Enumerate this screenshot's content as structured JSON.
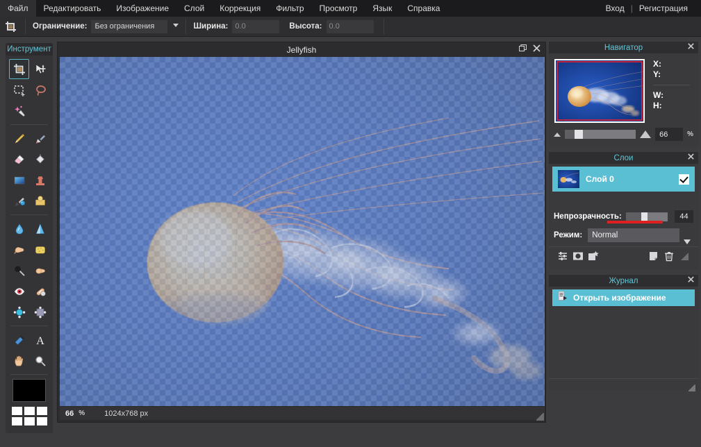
{
  "menu": {
    "items": [
      {
        "label": "Файл",
        "name": "menu-file"
      },
      {
        "label": "Редактировать",
        "name": "menu-edit"
      },
      {
        "label": "Изображение",
        "name": "menu-image"
      },
      {
        "label": "Слой",
        "name": "menu-layer"
      },
      {
        "label": "Коррекция",
        "name": "menu-adjustment"
      },
      {
        "label": "Фильтр",
        "name": "menu-filter"
      },
      {
        "label": "Просмотр",
        "name": "menu-view"
      },
      {
        "label": "Язык",
        "name": "menu-language"
      },
      {
        "label": "Справка",
        "name": "menu-help"
      }
    ],
    "login": "Вход",
    "separator": "|",
    "register": "Регистрация"
  },
  "options": {
    "tool_icon": "crop-icon",
    "constraint_label": "Ограничение:",
    "constraint_value": "Без ограничения",
    "width_label": "Ширина:",
    "width_value": "0.0",
    "height_label": "Высота:",
    "height_value": "0.0"
  },
  "tools": {
    "title": "Инструмент",
    "groups": [
      [
        {
          "icon": "crop-icon",
          "name": "tool-crop",
          "active": true
        },
        {
          "icon": "move-icon",
          "name": "tool-move",
          "active": false
        },
        {
          "icon": "marquee-select-icon",
          "name": "tool-marquee",
          "active": false
        },
        {
          "icon": "lasso-icon",
          "name": "tool-lasso",
          "active": false
        },
        {
          "icon": "magic-wand-icon",
          "name": "tool-magic-wand",
          "active": false
        }
      ],
      [
        {
          "icon": "pencil-icon",
          "name": "tool-pencil",
          "active": false
        },
        {
          "icon": "brush-icon",
          "name": "tool-brush",
          "active": false
        },
        {
          "icon": "eraser-icon",
          "name": "tool-eraser",
          "active": false
        },
        {
          "icon": "paint-bucket-icon",
          "name": "tool-paint-bucket",
          "active": false
        },
        {
          "icon": "gradient-icon",
          "name": "tool-gradient",
          "active": false
        },
        {
          "icon": "clone-stamp-icon",
          "name": "tool-clone-stamp",
          "active": false
        },
        {
          "icon": "color-replace-icon",
          "name": "tool-color-replace",
          "active": false
        },
        {
          "icon": "drawing-icon",
          "name": "tool-drawing",
          "active": false
        }
      ],
      [
        {
          "icon": "blur-drop-icon",
          "name": "tool-blur",
          "active": false
        },
        {
          "icon": "sharpen-icon",
          "name": "tool-sharpen",
          "active": false
        },
        {
          "icon": "smudge-finger-icon",
          "name": "tool-smudge",
          "active": false
        },
        {
          "icon": "sponge-icon",
          "name": "tool-sponge",
          "active": false
        },
        {
          "icon": "dodge-icon",
          "name": "tool-dodge",
          "active": false
        },
        {
          "icon": "burn-hand-icon",
          "name": "tool-burn",
          "active": false
        },
        {
          "icon": "red-eye-icon",
          "name": "tool-red-eye",
          "active": false
        },
        {
          "icon": "bandage-icon",
          "name": "tool-spot-heal",
          "active": false
        },
        {
          "icon": "bloat-icon",
          "name": "tool-bloat",
          "active": false
        },
        {
          "icon": "pinch-icon",
          "name": "tool-pinch",
          "active": false
        }
      ],
      [
        {
          "icon": "eyedropper-icon",
          "name": "tool-eyedropper",
          "active": false
        },
        {
          "icon": "text-icon",
          "name": "tool-text",
          "active": false
        },
        {
          "icon": "hand-icon",
          "name": "tool-hand",
          "active": false
        },
        {
          "icon": "zoom-magnifier-icon",
          "name": "tool-zoom",
          "active": false
        }
      ]
    ],
    "foreground_color": "#000000",
    "palette_colors": [
      "#ffffff",
      "#ffffff",
      "#ffffff",
      "#ffffff",
      "#ffffff",
      "#ffffff"
    ]
  },
  "document": {
    "title": "Jellyfish",
    "restore_icon": "restore-window-icon",
    "close_icon": "close-icon",
    "status_zoom": "66",
    "status_pct": "%",
    "status_size": "1024x768 px",
    "layer_opacity": 0.44
  },
  "navigator": {
    "title": "Навигатор",
    "close_icon": "close-icon",
    "x_label": "X:",
    "y_label": "Y:",
    "w_label": "W:",
    "h_label": "H:",
    "zoom_value": "66",
    "zoom_pct": "%"
  },
  "layers": {
    "title": "Слои",
    "close_icon": "close-icon",
    "rows": [
      {
        "name": "Слой 0",
        "visible": true
      }
    ],
    "opacity_label": "Непрозрачность:",
    "opacity_value": "44",
    "mode_label": "Режим:",
    "mode_value": "Normal",
    "buttons": [
      {
        "icon": "layer-settings-icon",
        "name": "layer-settings-button"
      },
      {
        "icon": "layer-mask-icon",
        "name": "layer-mask-button"
      },
      {
        "icon": "layer-style-icon",
        "name": "layer-style-button"
      },
      {
        "icon": "new-layer-icon",
        "name": "new-layer-button"
      },
      {
        "icon": "trash-icon",
        "name": "delete-layer-button"
      }
    ]
  },
  "history": {
    "title": "Журнал",
    "close_icon": "close-icon",
    "rows": [
      {
        "label": "Открыть изображение",
        "icon": "open-image-icon"
      }
    ]
  },
  "colors": {
    "accent_cyan": "#5ec8d8",
    "selection_blue": "#5bbfd4",
    "opacity_red": "#e02020",
    "panel_bg": "#3a3a3d",
    "menubar_bg": "#1b1b1d"
  }
}
